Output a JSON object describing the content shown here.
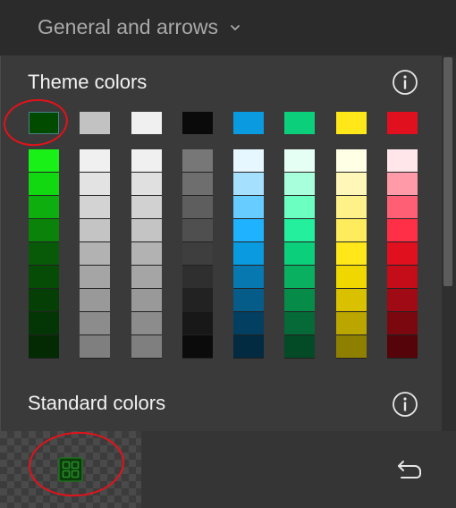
{
  "header": {
    "dropdown_label": "General and arrows"
  },
  "sections": {
    "theme": {
      "title": "Theme colors"
    },
    "standard": {
      "title": "Standard colors"
    }
  },
  "theme_colors": {
    "base_row": [
      "#004b00",
      "#c2c2c2",
      "#f0f0f0",
      "#0a0a0a",
      "#0a9ae0",
      "#0bcf7a",
      "#ffe71a",
      "#e0101e"
    ],
    "selected_index": 0,
    "shade_columns": [
      [
        "#18f018",
        "#12d812",
        "#0eae0e",
        "#0b830b",
        "#085908",
        "#064c06",
        "#053f05",
        "#043504",
        "#032a03"
      ],
      [
        "#f0f0f0",
        "#e3e3e3",
        "#d3d3d3",
        "#c4c4c4",
        "#b2b2b2",
        "#a5a5a5",
        "#999999",
        "#8c8c8c",
        "#7f7f7f"
      ],
      [
        "#f0f0f0",
        "#e0e0e0",
        "#d1d1d1",
        "#c4c4c4",
        "#b2b2b2",
        "#a5a5a5",
        "#999999",
        "#8c8c8c",
        "#7f7f7f"
      ],
      [
        "#777777",
        "#6e6e6e",
        "#5e5e5e",
        "#4f4f4f",
        "#3e3e3e",
        "#2f2f2f",
        "#222222",
        "#181818",
        "#0b0b0b"
      ],
      [
        "#e6f7ff",
        "#a6e0ff",
        "#67ccff",
        "#1eb2ff",
        "#0a9ae0",
        "#0778b0",
        "#055c88",
        "#033f60",
        "#022a41"
      ],
      [
        "#e6fff5",
        "#a8ffdc",
        "#6bffc2",
        "#23ef9d",
        "#0bcf7a",
        "#08b060",
        "#068b49",
        "#056a38",
        "#034a27"
      ],
      [
        "#ffffe6",
        "#fff7b8",
        "#fff18a",
        "#ffec5c",
        "#ffe71a",
        "#f0d700",
        "#d9c100",
        "#bba600",
        "#8f7f00"
      ],
      [
        "#ffe6ea",
        "#ff9aa8",
        "#ff5f74",
        "#ff2f47",
        "#e0101e",
        "#c40d19",
        "#a00a14",
        "#7c080f",
        "#55050a"
      ]
    ]
  },
  "bottom": {
    "transparent_label": "",
    "undo_label": ""
  },
  "icons": {
    "chevron": "chevron-down-icon",
    "info": "info-icon",
    "grid": "grid-icon",
    "undo": "undo-icon"
  }
}
